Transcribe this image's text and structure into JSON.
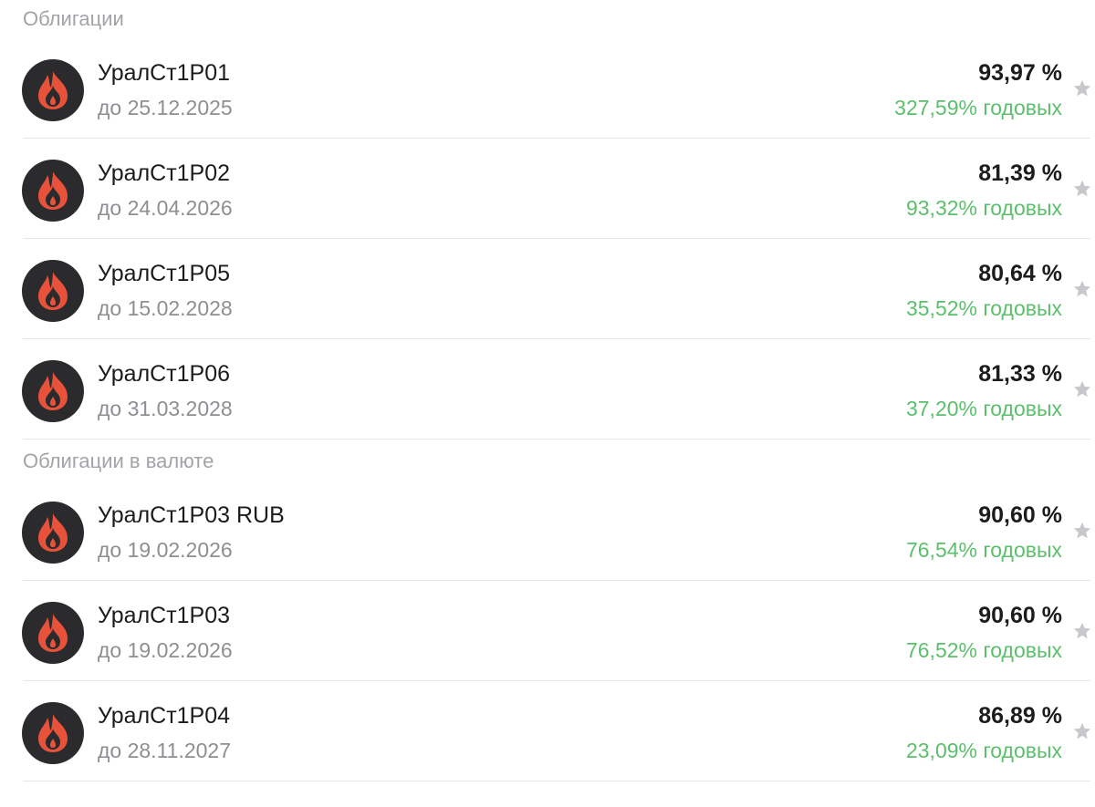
{
  "sections": [
    {
      "title": "Облигации",
      "items": [
        {
          "name": "УралСт1Р01",
          "maturity": "до 25.12.2025",
          "price": "93,97 %",
          "yield": "327,59% годовых"
        },
        {
          "name": "УралСт1Р02",
          "maturity": "до 24.04.2026",
          "price": "81,39 %",
          "yield": "93,32% годовых"
        },
        {
          "name": "УралСт1Р05",
          "maturity": "до 15.02.2028",
          "price": "80,64 %",
          "yield": "35,52% годовых"
        },
        {
          "name": "УралСт1Р06",
          "maturity": "до 31.03.2028",
          "price": "81,33 %",
          "yield": "37,20% годовых"
        }
      ]
    },
    {
      "title": "Облигации в валюте",
      "items": [
        {
          "name": "УралСт1Р03 RUB",
          "maturity": "до 19.02.2026",
          "price": "90,60 %",
          "yield": "76,54% годовых"
        },
        {
          "name": "УралСт1Р03",
          "maturity": "до 19.02.2026",
          "price": "90,60 %",
          "yield": "76,52% годовых"
        },
        {
          "name": "УралСт1Р04",
          "maturity": "до 28.11.2027",
          "price": "86,89 %",
          "yield": "23,09% годовых"
        }
      ]
    }
  ],
  "colors": {
    "logo_background": "#2b2b2d",
    "logo_flame": "#e8523a",
    "yield_positive": "#5cbf6c",
    "section_header": "#a3a3a8",
    "secondary_text": "#8e8e93",
    "star_inactive": "#c7c7cc"
  },
  "icons": {
    "logo": "flame-logo-icon",
    "favorite": "star-icon"
  }
}
